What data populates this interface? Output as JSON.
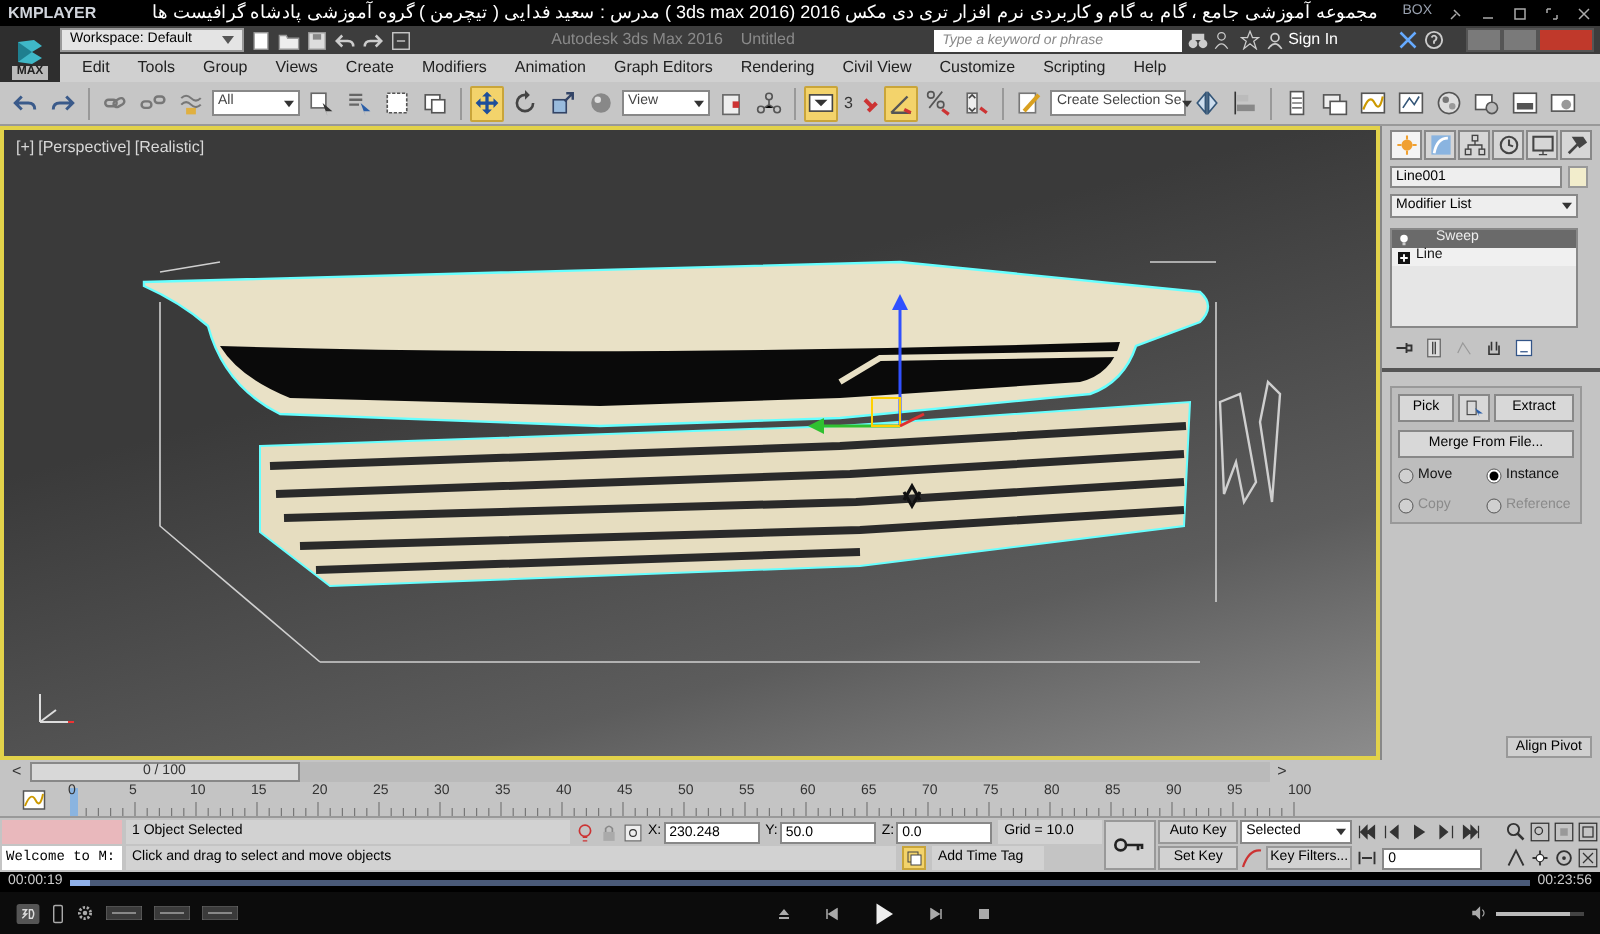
{
  "player": {
    "app_name": "KMPLAYER",
    "title": "مجموعه آموزشی جامع ، گام به گام و کاربردی نرم افزار تری دی مکس 2016 (3ds max 2016 )  مدرس : سعید فدایی ( تیچرمن ) گروه آموزشی پادشاه گرافیست ها",
    "badge": "BOX",
    "elapsed": "00:00:19",
    "duration": "00:23:56",
    "progress": {
      "level": 0.013
    },
    "volume": {
      "level": 0.85
    }
  },
  "app": {
    "logo_label": "MAX",
    "workspace": "Workspace: Default",
    "title": "Autodesk 3ds Max 2016    Untitled",
    "search": {
      "placeholder": "Type a keyword or phrase"
    },
    "sign_in": "Sign In"
  },
  "menu": [
    "Edit",
    "Tools",
    "Group",
    "Views",
    "Create",
    "Modifiers",
    "Animation",
    "Graph Editors",
    "Rendering",
    "Civil View",
    "Customize",
    "Scripting",
    "Help"
  ],
  "toolbar": [
    {
      "kind": "icon",
      "selected": false
    },
    {
      "kind": "icon",
      "selected": false
    },
    {
      "kind": "sep"
    },
    {
      "kind": "icon",
      "selected": false
    },
    {
      "kind": "icon",
      "selected": false
    },
    {
      "kind": "icon",
      "selected": false
    },
    {
      "kind": "dropdown",
      "value": "All"
    },
    {
      "kind": "icon",
      "selected": false
    },
    {
      "kind": "icon",
      "selected": false
    },
    {
      "kind": "icon",
      "selected": false
    },
    {
      "kind": "icon",
      "selected": false
    },
    {
      "kind": "sep"
    },
    {
      "kind": "icon",
      "selected": true
    },
    {
      "kind": "icon",
      "selected": false
    },
    {
      "kind": "icon",
      "selected": false
    },
    {
      "kind": "icon",
      "selected": false
    },
    {
      "kind": "dropdown",
      "value": "View"
    },
    {
      "kind": "icon",
      "selected": false
    },
    {
      "kind": "icon",
      "selected": false
    },
    {
      "kind": "sep"
    },
    {
      "kind": "icon",
      "selected": true
    },
    {
      "kind": "icon",
      "selected": false,
      "label": "3"
    },
    {
      "kind": "icon",
      "selected": true
    },
    {
      "kind": "icon",
      "selected": false
    },
    {
      "kind": "icon",
      "selected": false
    },
    {
      "kind": "sep"
    },
    {
      "kind": "icon",
      "selected": false
    },
    {
      "kind": "dropdown",
      "value": "Create Selection Se"
    },
    {
      "kind": "icon",
      "selected": false
    },
    {
      "kind": "icon",
      "selected": false
    },
    {
      "kind": "sep"
    },
    {
      "kind": "icon",
      "selected": false
    },
    {
      "kind": "icon",
      "selected": false
    },
    {
      "kind": "icon",
      "selected": false
    },
    {
      "kind": "icon",
      "selected": false
    },
    {
      "kind": "icon",
      "selected": false
    },
    {
      "kind": "icon",
      "selected": false
    },
    {
      "kind": "icon",
      "selected": false
    },
    {
      "kind": "icon",
      "selected": false
    }
  ],
  "viewport": {
    "labels": [
      "[+]",
      "[Perspective]",
      "[Realistic]"
    ]
  },
  "command_panel": {
    "tabs": [
      {
        "selected": true
      },
      {
        "selected": false
      },
      {
        "selected": false
      },
      {
        "selected": false
      },
      {
        "selected": false
      },
      {
        "selected": false
      }
    ],
    "object_name": "Line001",
    "modifier_list": "Modifier List",
    "stack": [
      {
        "label": "Sweep",
        "kind": "modifier",
        "selected": true
      },
      {
        "label": "Line",
        "kind": "base",
        "selected": false
      }
    ],
    "buttons": [
      "Pick",
      "Extract"
    ],
    "merge_button": "Merge From File...",
    "options": [
      {
        "label": "Move",
        "selected": false,
        "disabled": false
      },
      {
        "label": "Instance",
        "selected": true,
        "disabled": false
      },
      {
        "label": "Copy",
        "selected": false,
        "disabled": true
      },
      {
        "label": "Reference",
        "selected": false,
        "disabled": true
      }
    ],
    "align_button": "Align Pivot"
  },
  "timeline": {
    "slider": {
      "level": 0
    },
    "prev": "<",
    "next": ">",
    "position": "0 / 100",
    "ticks": [
      "0",
      "5",
      "10",
      "15",
      "20",
      "25",
      "30",
      "35",
      "40",
      "45",
      "50",
      "55",
      "60",
      "65",
      "70",
      "75",
      "80",
      "85",
      "90",
      "95",
      "100"
    ]
  },
  "status": {
    "listener": "Welcome to M:",
    "selection": "1 Object Selected",
    "prompt": "Click and drag to select and move objects",
    "coords": [
      {
        "label": "X:",
        "value": "230.248"
      },
      {
        "label": "Y:",
        "value": "50.0"
      },
      {
        "label": "Z:",
        "value": "0.0"
      }
    ],
    "grid": "Grid = 10.0",
    "add_time_tag": "Add Time Tag",
    "auto_key": "Auto Key",
    "set_key": "Set Key",
    "key_mode": "Selected",
    "key_filters": "Key Filters...",
    "frame": "0"
  }
}
